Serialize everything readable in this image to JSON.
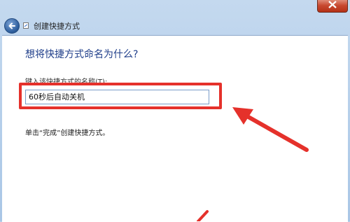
{
  "window": {
    "title": "创建快捷方式",
    "icons": {
      "back": "back-arrow-icon",
      "close": "close-icon",
      "wizard": "shortcut-icon"
    }
  },
  "page": {
    "question": "想将快捷方式命名为什么?",
    "field_label": "键入该快捷方式的名称(T):",
    "input_value": "60秒后自动关机",
    "instruction": "单击“完成”创建快捷方式。"
  },
  "colors": {
    "highlight": "#e5312b",
    "question_text": "#1f3e8a",
    "titlebar": "#b9d1ea"
  }
}
